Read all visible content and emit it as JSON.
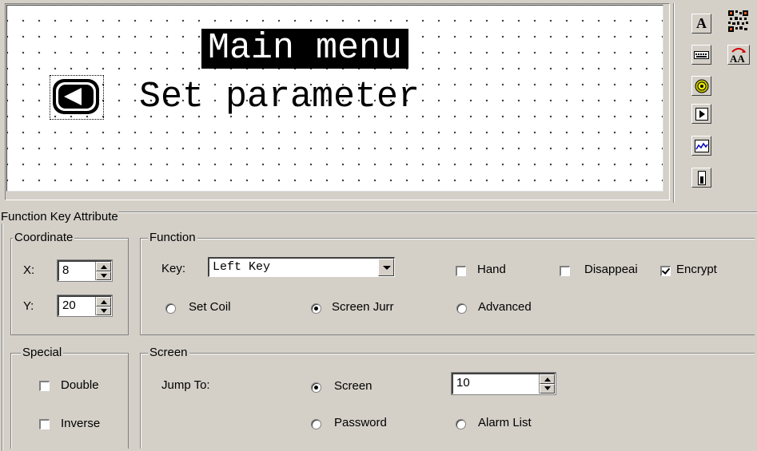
{
  "preview": {
    "title": "Main menu",
    "line": "Set parameter",
    "key_icon": "left-arrow-key-icon"
  },
  "toolbar": {
    "icons": [
      "text-icon",
      "qr-code-icon",
      "keypad-icon",
      "font-swap-icon",
      "indicator-light-icon",
      "function-key-icon",
      "trend-chart-icon",
      "meter-icon"
    ],
    "text_label": "A",
    "font_swap_label": "AA"
  },
  "attr": {
    "group_title": "Function Key Attribute",
    "coordinate": {
      "title": "Coordinate",
      "x_label": "X:",
      "x_value": "8",
      "y_label": "Y:",
      "y_value": "20"
    },
    "function": {
      "title": "Function",
      "key_label": "Key:",
      "key_value": "Left Key",
      "hand_label": "Hand",
      "hand_checked": false,
      "disappear_label": "Disappeai",
      "disappear_checked": false,
      "encrypt_label": "Encrypt",
      "encrypt_checked": true,
      "set_coil_label": "Set Coil",
      "screen_jump_label": "Screen Jurr",
      "advanced_label": "Advanced",
      "selected_mode": "Screen Jump"
    },
    "special": {
      "title": "Special",
      "double_label": "Double",
      "inverse_label": "Inverse"
    },
    "screen": {
      "title": "Screen",
      "jump_to_label": "Jump To:",
      "screen_label": "Screen",
      "password_label": "Password",
      "alarm_list_label": "Alarm List",
      "screen_value": "10",
      "selected": "Screen"
    }
  }
}
